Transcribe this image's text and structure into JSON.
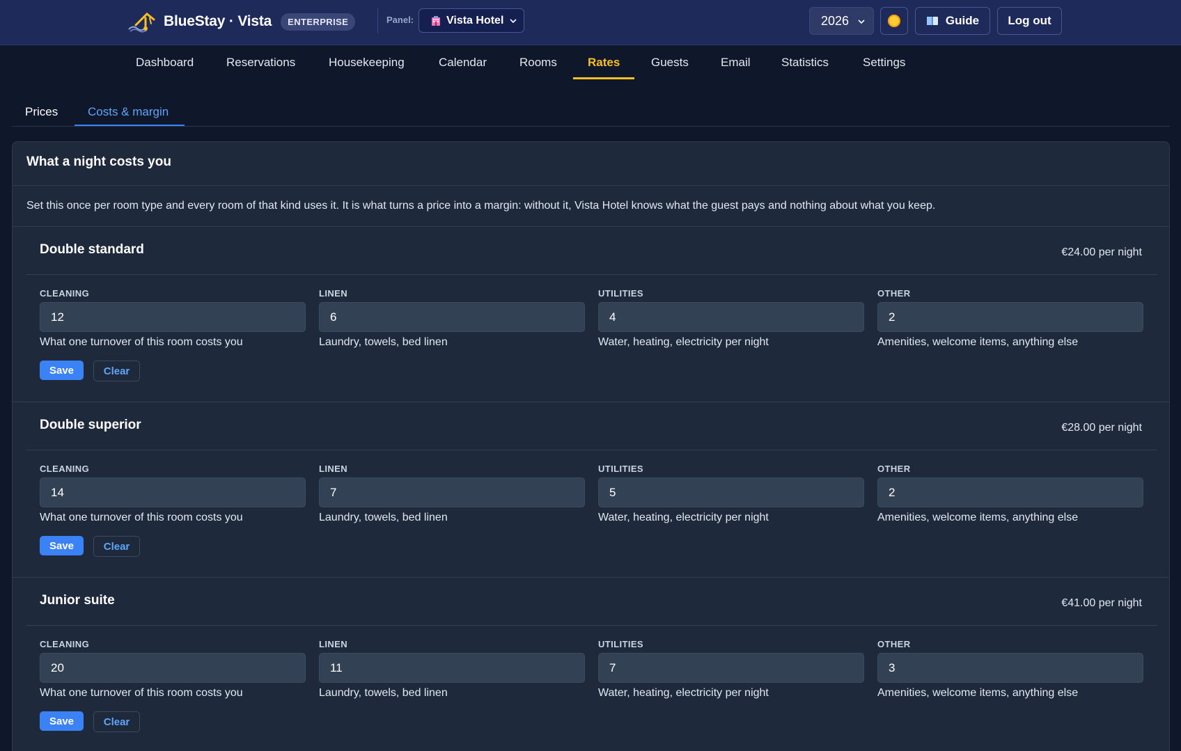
{
  "header": {
    "brand": "BlueStay · Vista",
    "plan_badge": "ENTERPRISE",
    "panel_label": "Panel:",
    "panel_value": "Vista Hotel",
    "year": "2026",
    "guide_label": "Guide",
    "logout_label": "Log out"
  },
  "nav": [
    {
      "label": "Dashboard"
    },
    {
      "label": "Reservations"
    },
    {
      "label": "Housekeeping"
    },
    {
      "label": "Calendar"
    },
    {
      "label": "Rooms"
    },
    {
      "label": "Rates",
      "active": true
    },
    {
      "label": "Guests"
    },
    {
      "label": "Email"
    },
    {
      "label": "Statistics"
    },
    {
      "label": "Settings"
    }
  ],
  "subtabs": {
    "prices": "Prices",
    "costs": "Costs & margin",
    "active": "costs"
  },
  "card": {
    "title": "What a night costs you",
    "description": "Set this once per room type and every room of that kind uses it. It is what turns a price into a margin: without it, Vista Hotel knows what the guest pays and nothing about what you keep."
  },
  "labels": {
    "cleaning": "CLEANING",
    "linen": "LINEN",
    "utilities": "UTILITIES",
    "other": "OTHER"
  },
  "hints": {
    "cleaning": "What one turnover of this room costs you",
    "linen": "Laundry, towels, bed linen",
    "utilities": "Water, heating, electricity per night",
    "other": "Amenities, welcome items, anything else"
  },
  "buttons": {
    "save": "Save",
    "clear": "Clear"
  },
  "rooms": [
    {
      "name": "Double standard",
      "total": "€24.00 per night",
      "cleaning": "12",
      "linen": "6",
      "utilities": "4",
      "other": "2"
    },
    {
      "name": "Double superior",
      "total": "€28.00 per night",
      "cleaning": "14",
      "linen": "7",
      "utilities": "5",
      "other": "2"
    },
    {
      "name": "Junior suite",
      "total": "€41.00 per night",
      "cleaning": "20",
      "linen": "11",
      "utilities": "7",
      "other": "3"
    }
  ],
  "colors": {
    "accent": "#fbbf24",
    "primary": "#3b82f6",
    "link": "#60a5fa",
    "topbar": "#1e2a5a",
    "background": "#0f172a",
    "card": "#1e293b"
  },
  "icons": {
    "logo": "bluestay-logo-icon",
    "hotel": "hotel-icon",
    "theme": "sun-icon",
    "guide": "book-icon",
    "dropdown": "chevron-down-icon"
  }
}
